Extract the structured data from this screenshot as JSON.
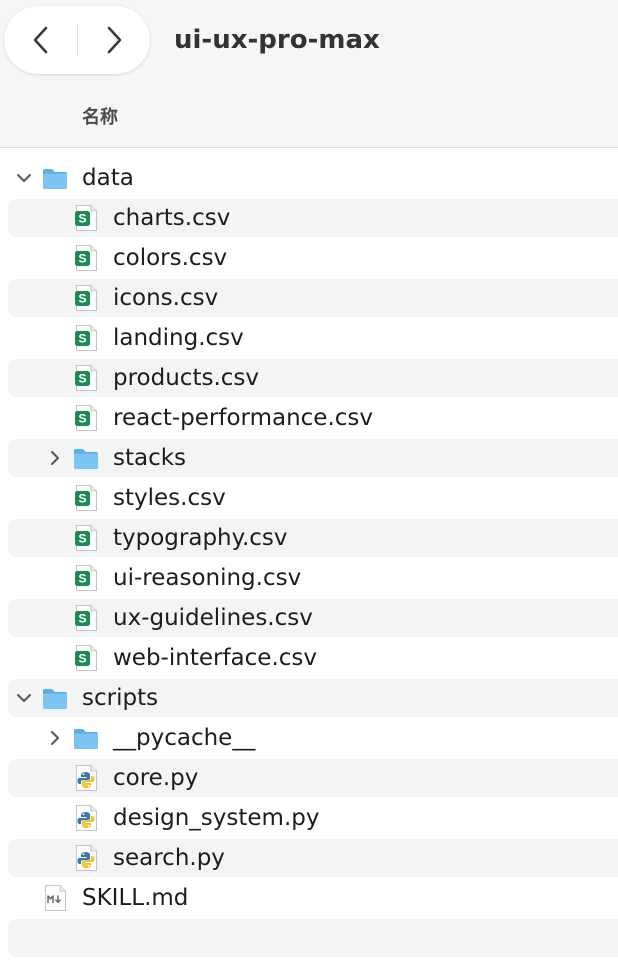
{
  "window": {
    "title": "ui-ux-pro-max"
  },
  "header": {
    "name_column": "名称"
  },
  "colors": {
    "folder": "#5fb3ea",
    "spreadsheet_green": "#1d8a4f",
    "stripe": "#f4f4f4"
  },
  "rows": [
    {
      "label": "data",
      "icon": "folder-icon",
      "level": 0,
      "disclosure": "expanded"
    },
    {
      "label": "charts.csv",
      "icon": "spreadsheet-icon",
      "level": 1,
      "disclosure": "none"
    },
    {
      "label": "colors.csv",
      "icon": "spreadsheet-icon",
      "level": 1,
      "disclosure": "none"
    },
    {
      "label": "icons.csv",
      "icon": "spreadsheet-icon",
      "level": 1,
      "disclosure": "none"
    },
    {
      "label": "landing.csv",
      "icon": "spreadsheet-icon",
      "level": 1,
      "disclosure": "none"
    },
    {
      "label": "products.csv",
      "icon": "spreadsheet-icon",
      "level": 1,
      "disclosure": "none"
    },
    {
      "label": "react-performance.csv",
      "icon": "spreadsheet-icon",
      "level": 1,
      "disclosure": "none"
    },
    {
      "label": "stacks",
      "icon": "folder-icon",
      "level": 1,
      "disclosure": "collapsed"
    },
    {
      "label": "styles.csv",
      "icon": "spreadsheet-icon",
      "level": 1,
      "disclosure": "none"
    },
    {
      "label": "typography.csv",
      "icon": "spreadsheet-icon",
      "level": 1,
      "disclosure": "none"
    },
    {
      "label": "ui-reasoning.csv",
      "icon": "spreadsheet-icon",
      "level": 1,
      "disclosure": "none"
    },
    {
      "label": "ux-guidelines.csv",
      "icon": "spreadsheet-icon",
      "level": 1,
      "disclosure": "none"
    },
    {
      "label": "web-interface.csv",
      "icon": "spreadsheet-icon",
      "level": 1,
      "disclosure": "none"
    },
    {
      "label": "scripts",
      "icon": "folder-icon",
      "level": 0,
      "disclosure": "expanded"
    },
    {
      "label": "__pycache__",
      "icon": "folder-icon",
      "level": 1,
      "disclosure": "collapsed"
    },
    {
      "label": "core.py",
      "icon": "python-file-icon",
      "level": 1,
      "disclosure": "none"
    },
    {
      "label": "design_system.py",
      "icon": "python-file-icon",
      "level": 1,
      "disclosure": "none"
    },
    {
      "label": "search.py",
      "icon": "python-file-icon",
      "level": 1,
      "disclosure": "none"
    },
    {
      "label": "SKILL.md",
      "icon": "markdown-file-icon",
      "level": 0,
      "disclosure": "none"
    }
  ]
}
